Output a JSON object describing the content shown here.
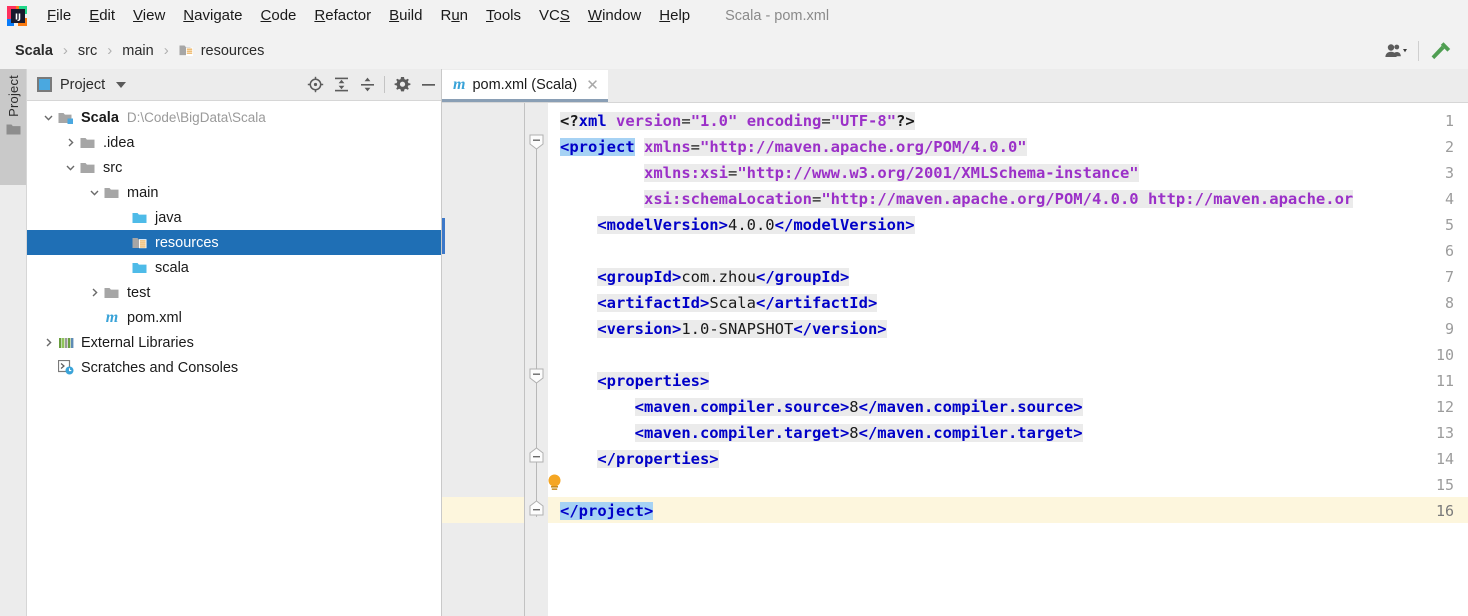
{
  "app": {
    "window_title": "Scala - pom.xml",
    "logo_icon": "intellij-idea-logo"
  },
  "menubar": {
    "items": [
      {
        "label": "File",
        "mnemonic": "F"
      },
      {
        "label": "Edit",
        "mnemonic": "E"
      },
      {
        "label": "View",
        "mnemonic": "V"
      },
      {
        "label": "Navigate",
        "mnemonic": "N"
      },
      {
        "label": "Code",
        "mnemonic": "C"
      },
      {
        "label": "Refactor",
        "mnemonic": "R"
      },
      {
        "label": "Build",
        "mnemonic": "B"
      },
      {
        "label": "Run",
        "mnemonic": "u"
      },
      {
        "label": "Tools",
        "mnemonic": "T"
      },
      {
        "label": "VCS",
        "mnemonic": "S"
      },
      {
        "label": "Window",
        "mnemonic": "W"
      },
      {
        "label": "Help",
        "mnemonic": "H"
      }
    ]
  },
  "navbar": {
    "breadcrumbs": [
      {
        "label": "Scala",
        "icon": "none"
      },
      {
        "label": "src",
        "icon": "none"
      },
      {
        "label": "main",
        "icon": "none"
      },
      {
        "label": "resources",
        "icon": "resources-folder-icon"
      }
    ],
    "separator": "›",
    "right_actions": [
      {
        "name": "user-account-icon",
        "label": ""
      },
      {
        "name": "chevron-down-icon",
        "label": ""
      },
      {
        "name": "build-hammer-icon",
        "label": ""
      }
    ]
  },
  "stripe": {
    "project_button_label": "Project",
    "project_button_icon": "folder-icon"
  },
  "project_panel": {
    "title": "Project",
    "title_icon": "project-view-icon",
    "dropdown_icon": "chevron-down-icon",
    "actions": [
      {
        "name": "locate-target-icon",
        "tooltip": "Select Opened File"
      },
      {
        "name": "expand-all-icon",
        "tooltip": "Expand All"
      },
      {
        "name": "collapse-all-icon",
        "tooltip": "Collapse All"
      },
      {
        "name": "settings-gear-icon",
        "tooltip": "Settings"
      },
      {
        "name": "hide-minimize-icon",
        "tooltip": "Hide"
      }
    ],
    "tree": [
      {
        "label": "Scala",
        "path": "D:\\Code\\BigData\\Scala",
        "depth": 0,
        "twist": "down",
        "icon": "module-folder-icon",
        "bold": true,
        "selected": false
      },
      {
        "label": ".idea",
        "path": "",
        "depth": 1,
        "twist": "right",
        "icon": "folder-icon",
        "bold": false,
        "selected": false
      },
      {
        "label": "src",
        "path": "",
        "depth": 1,
        "twist": "down",
        "icon": "folder-icon",
        "bold": false,
        "selected": false
      },
      {
        "label": "main",
        "path": "",
        "depth": 2,
        "twist": "down",
        "icon": "folder-icon",
        "bold": false,
        "selected": false
      },
      {
        "label": "java",
        "path": "",
        "depth": 3,
        "twist": "none",
        "icon": "source-folder-icon",
        "bold": false,
        "selected": false
      },
      {
        "label": "resources",
        "path": "",
        "depth": 3,
        "twist": "none",
        "icon": "resources-folder-icon",
        "bold": false,
        "selected": true
      },
      {
        "label": "scala",
        "path": "",
        "depth": 3,
        "twist": "none",
        "icon": "source-folder-icon",
        "bold": false,
        "selected": false
      },
      {
        "label": "test",
        "path": "",
        "depth": 2,
        "twist": "right",
        "icon": "folder-icon",
        "bold": false,
        "selected": false
      },
      {
        "label": "pom.xml",
        "path": "",
        "depth": 2,
        "twist": "none",
        "icon": "maven-file-icon",
        "bold": false,
        "selected": false
      },
      {
        "label": "External Libraries",
        "path": "",
        "depth": 0,
        "twist": "right",
        "icon": "libraries-icon",
        "bold": false,
        "selected": false
      },
      {
        "label": "Scratches and Consoles",
        "path": "",
        "depth": 0,
        "twist": "none",
        "icon": "scratches-icon",
        "bold": false,
        "selected": false
      }
    ]
  },
  "editor": {
    "tab": {
      "label": "pom.xml (Scala)",
      "icon": "maven-file-icon",
      "close_icon": "close-icon",
      "active": true
    },
    "current_line": 16,
    "line_numbers": [
      1,
      2,
      3,
      4,
      5,
      6,
      7,
      8,
      9,
      10,
      11,
      12,
      13,
      14,
      15,
      16
    ],
    "intention_bulb": {
      "icon": "lightbulb-icon",
      "line": 15
    },
    "fold_markers": [
      {
        "line": 2,
        "state": "expanded"
      },
      {
        "line": 11,
        "state": "expanded"
      },
      {
        "line": 14,
        "state": "end"
      },
      {
        "line": 16,
        "state": "end"
      }
    ],
    "lines": [
      {
        "n": 1,
        "tokens": [
          {
            "t": "<?",
            "c": "pimark"
          },
          {
            "t": "xml",
            "c": "pi"
          },
          {
            "t": " ",
            "c": "txt"
          },
          {
            "t": "version",
            "c": "attr"
          },
          {
            "t": "=",
            "c": "txt"
          },
          {
            "t": "\"1.0\"",
            "c": "aval"
          },
          {
            "t": " ",
            "c": "txt"
          },
          {
            "t": "encoding",
            "c": "attr"
          },
          {
            "t": "=",
            "c": "txt"
          },
          {
            "t": "\"UTF-8\"",
            "c": "aval"
          },
          {
            "t": "?>",
            "c": "pimark"
          }
        ]
      },
      {
        "n": 2,
        "tokens": [
          {
            "t": "<project",
            "c": "seltag"
          },
          {
            "t": " ",
            "c": "plain"
          },
          {
            "t": "xmlns",
            "c": "attr"
          },
          {
            "t": "=",
            "c": "txt"
          },
          {
            "t": "\"http://maven.apache.org/POM/4.0.0\"",
            "c": "aval"
          }
        ]
      },
      {
        "n": 3,
        "tokens": [
          {
            "t": "         ",
            "c": "plain"
          },
          {
            "t": "xmlns:xsi",
            "c": "attr"
          },
          {
            "t": "=",
            "c": "txt"
          },
          {
            "t": "\"http://www.w3.org/2001/XMLSchema-instance\"",
            "c": "aval"
          }
        ]
      },
      {
        "n": 4,
        "tokens": [
          {
            "t": "         ",
            "c": "plain"
          },
          {
            "t": "xsi:schemaLocation",
            "c": "attr"
          },
          {
            "t": "=",
            "c": "txt"
          },
          {
            "t": "\"http://maven.apache.org/POM/4.0.0 http://maven.apache.or",
            "c": "aval"
          }
        ]
      },
      {
        "n": 5,
        "tokens": [
          {
            "t": "    ",
            "c": "plain"
          },
          {
            "t": "<modelVersion>",
            "c": "tag"
          },
          {
            "t": "4.0.0",
            "c": "txt"
          },
          {
            "t": "</modelVersion>",
            "c": "tag"
          }
        ]
      },
      {
        "n": 6,
        "tokens": []
      },
      {
        "n": 7,
        "tokens": [
          {
            "t": "    ",
            "c": "plain"
          },
          {
            "t": "<groupId>",
            "c": "tag"
          },
          {
            "t": "com.zhou",
            "c": "txt"
          },
          {
            "t": "</groupId>",
            "c": "tag"
          }
        ]
      },
      {
        "n": 8,
        "tokens": [
          {
            "t": "    ",
            "c": "plain"
          },
          {
            "t": "<artifactId>",
            "c": "tag"
          },
          {
            "t": "Scala",
            "c": "txt"
          },
          {
            "t": "</artifactId>",
            "c": "tag"
          }
        ]
      },
      {
        "n": 9,
        "tokens": [
          {
            "t": "    ",
            "c": "plain"
          },
          {
            "t": "<version>",
            "c": "tag"
          },
          {
            "t": "1.0-SNAPSHOT",
            "c": "txt"
          },
          {
            "t": "</version>",
            "c": "tag"
          }
        ]
      },
      {
        "n": 10,
        "tokens": []
      },
      {
        "n": 11,
        "tokens": [
          {
            "t": "    ",
            "c": "plain"
          },
          {
            "t": "<properties>",
            "c": "tag"
          }
        ]
      },
      {
        "n": 12,
        "tokens": [
          {
            "t": "        ",
            "c": "plain"
          },
          {
            "t": "<maven.compiler.source>",
            "c": "tag"
          },
          {
            "t": "8",
            "c": "txt"
          },
          {
            "t": "</maven.compiler.source>",
            "c": "tag"
          }
        ]
      },
      {
        "n": 13,
        "tokens": [
          {
            "t": "        ",
            "c": "plain"
          },
          {
            "t": "<maven.compiler.target>",
            "c": "tag"
          },
          {
            "t": "8",
            "c": "txt"
          },
          {
            "t": "</maven.compiler.target>",
            "c": "tag"
          }
        ]
      },
      {
        "n": 14,
        "tokens": [
          {
            "t": "    ",
            "c": "plain"
          },
          {
            "t": "</properties>",
            "c": "tag"
          }
        ]
      },
      {
        "n": 15,
        "tokens": []
      },
      {
        "n": 16,
        "tokens": [
          {
            "t": "</project>",
            "c": "seltag"
          }
        ]
      }
    ]
  },
  "colors": {
    "selection_blue": "#1f6fb5",
    "token_selection": "#a6d2f4",
    "current_line": "#fdf6dd",
    "tag_blue": "#0000c8",
    "attr_purple": "#9b30c8",
    "panel_gray": "#ececec",
    "accent_green": "#4f9e52"
  }
}
